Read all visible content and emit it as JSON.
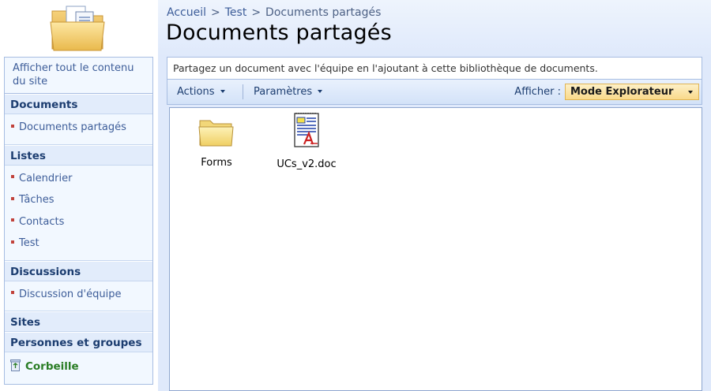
{
  "breadcrumb": {
    "items": [
      "Accueil",
      "Test",
      "Documents partagés"
    ],
    "separator": ">"
  },
  "page": {
    "title": "Documents partagés",
    "description": "Partagez un document avec l'équipe en l'ajoutant à cette bibliothèque de documents."
  },
  "leftnav": {
    "view_all": "Afficher tout le contenu du site",
    "sections": {
      "documents": {
        "heading": "Documents",
        "items": [
          "Documents partagés"
        ]
      },
      "lists": {
        "heading": "Listes",
        "items": [
          "Calendrier",
          "Tâches",
          "Contacts",
          "Test"
        ]
      },
      "discussions": {
        "heading": "Discussions",
        "items": [
          "Discussion d'équipe"
        ]
      },
      "sites": {
        "heading": "Sites"
      },
      "people": {
        "heading": "Personnes et groupes"
      }
    },
    "recycle_bin": "Corbeille"
  },
  "toolbar": {
    "actions": "Actions",
    "settings": "Paramètres",
    "view_label": "Afficher :",
    "view_value": "Mode Explorateur"
  },
  "files": [
    {
      "name": "Forms",
      "icon": "folder-icon"
    },
    {
      "name": "UCs_v2.doc",
      "icon": "word-document-icon"
    }
  ],
  "colors": {
    "header_bg": "#dfe9fb",
    "nav_bg": "#f2f8ff",
    "nav_heading_bg": "#e2ecfb",
    "link": "#3d5d99",
    "heading_text": "#1c3d70",
    "bullet": "#c1423b",
    "recycle_text": "#2a7d25",
    "view_select_bg": "#f9d98a"
  }
}
